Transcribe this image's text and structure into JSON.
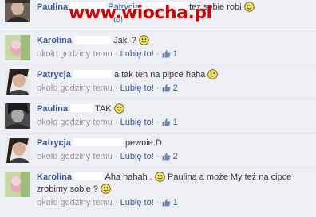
{
  "watermark": "www.wiocha.pl",
  "like_label": "Lubię to!",
  "comments": [
    {
      "name": "Paulina",
      "name2": "Patrycja",
      "text": "tez sobie robi",
      "time": "",
      "likes": ""
    },
    {
      "name": "Karolina",
      "text": "Jaki ?",
      "time": "około godziny temu",
      "likes": "1"
    },
    {
      "name": "Patrycja",
      "text": "a tak ten na pipce haha",
      "time": "około godziny temu",
      "likes": "2"
    },
    {
      "name": "Paulina",
      "text": "TAK",
      "time": "około godziny temu",
      "likes": "1"
    },
    {
      "name": "Patrycja",
      "text": "pewnie:D",
      "time": "około godziny temu",
      "likes": "2"
    },
    {
      "name": "Karolina",
      "text": "Aha hahah .",
      "text2": "Paulina a może My też na cipce",
      "text3": "zrobimy sobie ?",
      "time": "około godziny temu",
      "likes": "1"
    }
  ],
  "colors": {
    "link": "#3b5998",
    "bg": "#edeff4",
    "meta": "#999999"
  }
}
